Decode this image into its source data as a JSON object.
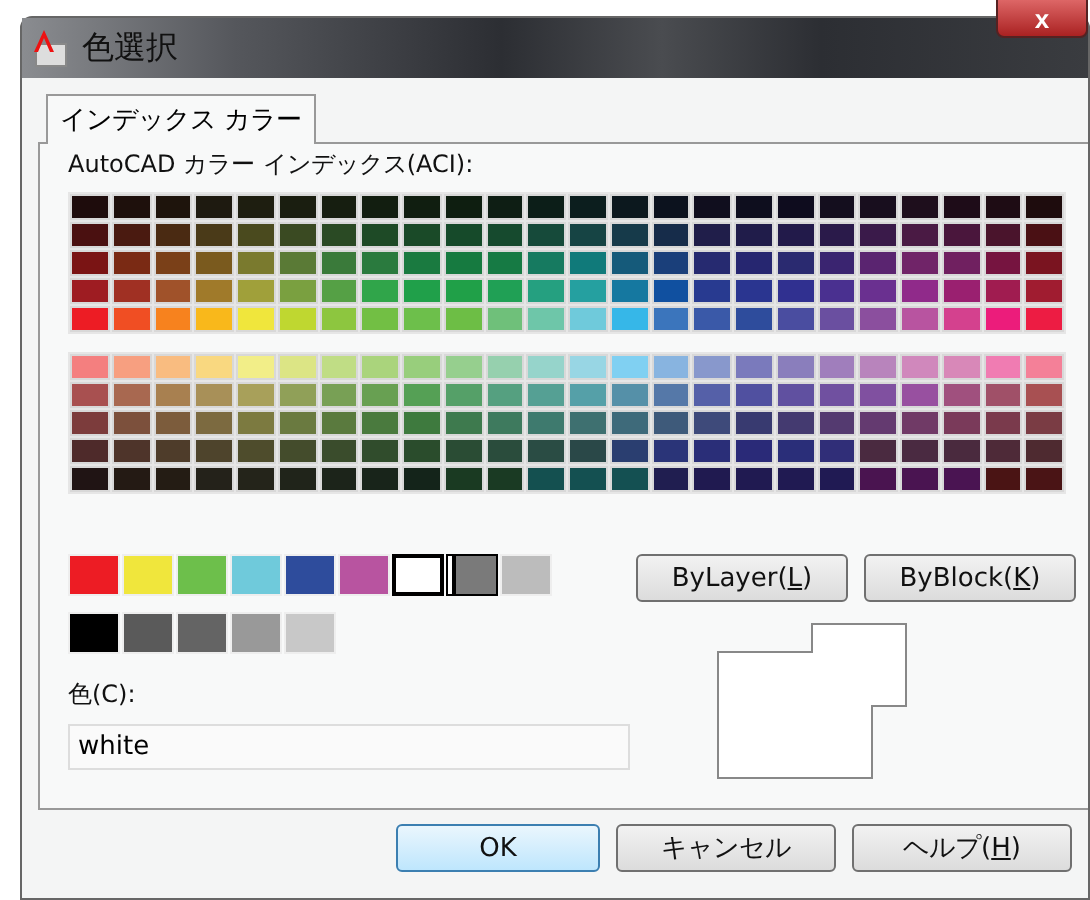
{
  "window": {
    "title": "色選択",
    "close": "x"
  },
  "tabs": [
    {
      "label": "インデックス カラー",
      "selected": true
    }
  ],
  "palette_label": "AutoCAD カラー インデックス(ACI):",
  "palette": {
    "upper_rows": [
      {
        "cells": [
          {
            "color": "#1e0c0c"
          },
          {
            "color": "#1e100c"
          },
          {
            "color": "#1e140c"
          },
          {
            "color": "#1e1a10"
          },
          {
            "color": "#1e1e10"
          },
          {
            "color": "#1a1e10"
          },
          {
            "color": "#161e10"
          },
          {
            "color": "#121e10"
          },
          {
            "color": "#101e10"
          },
          {
            "color": "#0e1e10"
          },
          {
            "color": "#0e1e14"
          },
          {
            "color": "#0c1e18"
          },
          {
            "color": "#0c1e1e"
          },
          {
            "color": "#0c181e"
          },
          {
            "color": "#0c121e"
          },
          {
            "color": "#100e1e"
          },
          {
            "color": "#0e0e1e"
          },
          {
            "color": "#0e0c1e"
          },
          {
            "color": "#140e1e"
          },
          {
            "color": "#180e1e"
          },
          {
            "color": "#1e0e1c"
          },
          {
            "color": "#1e0c18"
          },
          {
            "color": "#1e0c14"
          },
          {
            "color": "#1e0c0d"
          }
        ]
      },
      {
        "cells": [
          {
            "color": "#4a1010"
          },
          {
            "color": "#4a1a10"
          },
          {
            "color": "#4a2a12"
          },
          {
            "color": "#4a3a18"
          },
          {
            "color": "#4a4a1e"
          },
          {
            "color": "#3a4a22"
          },
          {
            "color": "#2a4a24"
          },
          {
            "color": "#1e4a26"
          },
          {
            "color": "#1a4a28"
          },
          {
            "color": "#164a2a"
          },
          {
            "color": "#164a2e"
          },
          {
            "color": "#164a3a"
          },
          {
            "color": "#164444"
          },
          {
            "color": "#163a4a"
          },
          {
            "color": "#162c4a"
          },
          {
            "color": "#201e4a"
          },
          {
            "color": "#201c4a"
          },
          {
            "color": "#221a4a"
          },
          {
            "color": "#2a1a4a"
          },
          {
            "color": "#3a1a4a"
          },
          {
            "color": "#4a1a44"
          },
          {
            "color": "#4a163c"
          },
          {
            "color": "#4a142c"
          },
          {
            "color": "#4a1014"
          }
        ]
      },
      {
        "cells": [
          {
            "color": "#7a1414"
          },
          {
            "color": "#7a2a14"
          },
          {
            "color": "#7a4018"
          },
          {
            "color": "#7a5a1e"
          },
          {
            "color": "#7a7a2e"
          },
          {
            "color": "#5a7a36"
          },
          {
            "color": "#3a7a3a"
          },
          {
            "color": "#2a7a3e"
          },
          {
            "color": "#1a7a40"
          },
          {
            "color": "#167a40"
          },
          {
            "color": "#167a44"
          },
          {
            "color": "#167a60"
          },
          {
            "color": "#107a7a"
          },
          {
            "color": "#155a7a"
          },
          {
            "color": "#1a3f7a"
          },
          {
            "color": "#262a70"
          },
          {
            "color": "#262670"
          },
          {
            "color": "#2a2a70"
          },
          {
            "color": "#3a2470"
          },
          {
            "color": "#5a2470"
          },
          {
            "color": "#702468"
          },
          {
            "color": "#702060"
          },
          {
            "color": "#761440"
          },
          {
            "color": "#7a1420"
          }
        ]
      },
      {
        "cells": [
          {
            "color": "#9e1c22"
          },
          {
            "color": "#a03023"
          },
          {
            "color": "#a0522a"
          },
          {
            "color": "#a07a2a"
          },
          {
            "color": "#a0a03a"
          },
          {
            "color": "#7aa040"
          },
          {
            "color": "#55a045"
          },
          {
            "color": "#30a54a"
          },
          {
            "color": "#20a04a"
          },
          {
            "color": "#20a048"
          },
          {
            "color": "#20a055"
          },
          {
            "color": "#25a080"
          },
          {
            "color": "#25a0a0"
          },
          {
            "color": "#1578a0"
          },
          {
            "color": "#1050a0"
          },
          {
            "color": "#283a90"
          },
          {
            "color": "#2a3590"
          },
          {
            "color": "#303090"
          },
          {
            "color": "#4a3090"
          },
          {
            "color": "#6a3090"
          },
          {
            "color": "#902a8a"
          },
          {
            "color": "#9a2070"
          },
          {
            "color": "#a01c50"
          },
          {
            "color": "#a01c30"
          }
        ]
      },
      {
        "cells": [
          {
            "color": "#ed1c24"
          },
          {
            "color": "#f04e23"
          },
          {
            "color": "#f7821e"
          },
          {
            "color": "#f9b81b"
          },
          {
            "color": "#f0e63c"
          },
          {
            "color": "#bfd730"
          },
          {
            "color": "#8dc63f"
          },
          {
            "color": "#72bf44"
          },
          {
            "color": "#6dbf4b"
          },
          {
            "color": "#6dbe45"
          },
          {
            "color": "#6fc07a"
          },
          {
            "color": "#6ec6a9"
          },
          {
            "color": "#6fcadb"
          },
          {
            "color": "#36b7e8"
          },
          {
            "color": "#3b75bc"
          },
          {
            "color": "#3a59a8"
          },
          {
            "color": "#2e4c9c"
          },
          {
            "color": "#4a4da0"
          },
          {
            "color": "#6a4fa0"
          },
          {
            "color": "#8b4f9e"
          },
          {
            "color": "#b854a0"
          },
          {
            "color": "#d4418e"
          },
          {
            "color": "#ec1c7b"
          },
          {
            "color": "#ed1c43"
          }
        ]
      }
    ],
    "lower_rows": [
      {
        "cells": [
          {
            "color": "#f47f7f"
          },
          {
            "color": "#f79f80"
          },
          {
            "color": "#f9bc80"
          },
          {
            "color": "#f9d880"
          },
          {
            "color": "#f2ee88"
          },
          {
            "color": "#dce585"
          },
          {
            "color": "#c0dd85"
          },
          {
            "color": "#aad47c"
          },
          {
            "color": "#98ce7c"
          },
          {
            "color": "#96cf8e"
          },
          {
            "color": "#96d0ae"
          },
          {
            "color": "#96d4cb"
          },
          {
            "color": "#98d6e4"
          },
          {
            "color": "#80d0f2"
          },
          {
            "color": "#88b4e0"
          },
          {
            "color": "#8898cc"
          },
          {
            "color": "#7a7abc"
          },
          {
            "color": "#8a7ebc"
          },
          {
            "color": "#a07ebc"
          },
          {
            "color": "#b884bc"
          },
          {
            "color": "#d088bc"
          },
          {
            "color": "#d888b8"
          },
          {
            "color": "#f07cb2"
          },
          {
            "color": "#f48098"
          }
        ]
      },
      {
        "cells": [
          {
            "color": "#a85050"
          },
          {
            "color": "#a86850"
          },
          {
            "color": "#a88050"
          },
          {
            "color": "#a89058"
          },
          {
            "color": "#a8a05a"
          },
          {
            "color": "#90a058"
          },
          {
            "color": "#78a055"
          },
          {
            "color": "#68a052"
          },
          {
            "color": "#55a055"
          },
          {
            "color": "#55a068"
          },
          {
            "color": "#55a080"
          },
          {
            "color": "#55a094"
          },
          {
            "color": "#55a0a8"
          },
          {
            "color": "#5590a8"
          },
          {
            "color": "#5578a8"
          },
          {
            "color": "#5560a8"
          },
          {
            "color": "#5050a0"
          },
          {
            "color": "#6050a0"
          },
          {
            "color": "#7050a0"
          },
          {
            "color": "#8050a0"
          },
          {
            "color": "#9850a0"
          },
          {
            "color": "#a0507e"
          },
          {
            "color": "#a05068"
          },
          {
            "color": "#a85052"
          }
        ]
      },
      {
        "cells": [
          {
            "color": "#7c3c3c"
          },
          {
            "color": "#7c503c"
          },
          {
            "color": "#7c5c3c"
          },
          {
            "color": "#7c6a40"
          },
          {
            "color": "#7c7a40"
          },
          {
            "color": "#6a7a40"
          },
          {
            "color": "#5a7a3e"
          },
          {
            "color": "#4a7a3e"
          },
          {
            "color": "#3e7a3e"
          },
          {
            "color": "#3e7a4e"
          },
          {
            "color": "#3e7a5e"
          },
          {
            "color": "#3e7a6e"
          },
          {
            "color": "#3e7070"
          },
          {
            "color": "#3e6a7a"
          },
          {
            "color": "#3e5a7a"
          },
          {
            "color": "#3e4a7a"
          },
          {
            "color": "#383a70"
          },
          {
            "color": "#443a70"
          },
          {
            "color": "#543a70"
          },
          {
            "color": "#643a70"
          },
          {
            "color": "#703a66"
          },
          {
            "color": "#7a3a5a"
          },
          {
            "color": "#7a3a4c"
          },
          {
            "color": "#7a3c44"
          }
        ]
      },
      {
        "cells": [
          {
            "color": "#4e2a2a"
          },
          {
            "color": "#4e342a"
          },
          {
            "color": "#4e3c2a"
          },
          {
            "color": "#4e442c"
          },
          {
            "color": "#4e4c2c"
          },
          {
            "color": "#444c2c"
          },
          {
            "color": "#3a4c2c"
          },
          {
            "color": "#304c2c"
          },
          {
            "color": "#2a4c2c"
          },
          {
            "color": "#2a4c34"
          },
          {
            "color": "#2a4c3c"
          },
          {
            "color": "#2a4c44"
          },
          {
            "color": "#2a4848"
          },
          {
            "color": "#2a3e70"
          },
          {
            "color": "#2a3478"
          },
          {
            "color": "#2a2e78"
          },
          {
            "color": "#2a2a78"
          },
          {
            "color": "#2a2e79"
          },
          {
            "color": "#302e78"
          },
          {
            "color": "#4a2a40"
          },
          {
            "color": "#4a2a41"
          },
          {
            "color": "#4a2a3e"
          },
          {
            "color": "#4e2a38"
          },
          {
            "color": "#4e2a30"
          }
        ]
      },
      {
        "cells": [
          {
            "color": "#201414"
          },
          {
            "color": "#241a14"
          },
          {
            "color": "#241c14"
          },
          {
            "color": "#24221a"
          },
          {
            "color": "#24241a"
          },
          {
            "color": "#20241a"
          },
          {
            "color": "#1c241a"
          },
          {
            "color": "#18241a"
          },
          {
            "color": "#14241a"
          },
          {
            "color": "#1a3a22"
          },
          {
            "color": "#1a3a23"
          },
          {
            "color": "#145050"
          },
          {
            "color": "#145051"
          },
          {
            "color": "#145052"
          },
          {
            "color": "#201e50"
          },
          {
            "color": "#201a50"
          },
          {
            "color": "#201a51"
          },
          {
            "color": "#201a52"
          },
          {
            "color": "#201a53"
          },
          {
            "color": "#4a1450"
          },
          {
            "color": "#4a1451"
          },
          {
            "color": "#4a1452"
          },
          {
            "color": "#4a1414"
          },
          {
            "color": "#4a1415"
          }
        ]
      }
    ]
  },
  "standard_colors": [
    {
      "color": "#ed1c24",
      "selected": false,
      "focused": false
    },
    {
      "color": "#f0e63c",
      "selected": false,
      "focused": false
    },
    {
      "color": "#6dbf4b",
      "selected": false,
      "focused": false
    },
    {
      "color": "#6fcadb",
      "selected": false,
      "focused": false
    },
    {
      "color": "#2e4c9c",
      "selected": false,
      "focused": false
    },
    {
      "color": "#b854a0",
      "selected": false,
      "focused": false
    },
    {
      "color": "#ffffff",
      "selected": true,
      "focused": false
    },
    {
      "color": "#7a7a7a",
      "selected": false,
      "focused": true
    },
    {
      "color": "#bcbcbc",
      "selected": false,
      "focused": false
    }
  ],
  "gray_colors": [
    {
      "color": "#000000"
    },
    {
      "color": "#5a5a5a"
    },
    {
      "color": "#646464"
    },
    {
      "color": "#999999"
    },
    {
      "color": "#c8c8c8"
    }
  ],
  "by_buttons": [
    {
      "label": "ByLayer(",
      "key": "L",
      "end": ")"
    },
    {
      "label": "ByBlock(",
      "key": "K",
      "end": ")"
    }
  ],
  "color_field": {
    "label": "色(C):",
    "value": "white"
  },
  "buttons": [
    {
      "label": "OK",
      "default": true
    },
    {
      "label": "キャンセル",
      "default": false
    },
    {
      "label": "ヘルプ(",
      "key": "H",
      "end": ")",
      "default": false
    }
  ]
}
